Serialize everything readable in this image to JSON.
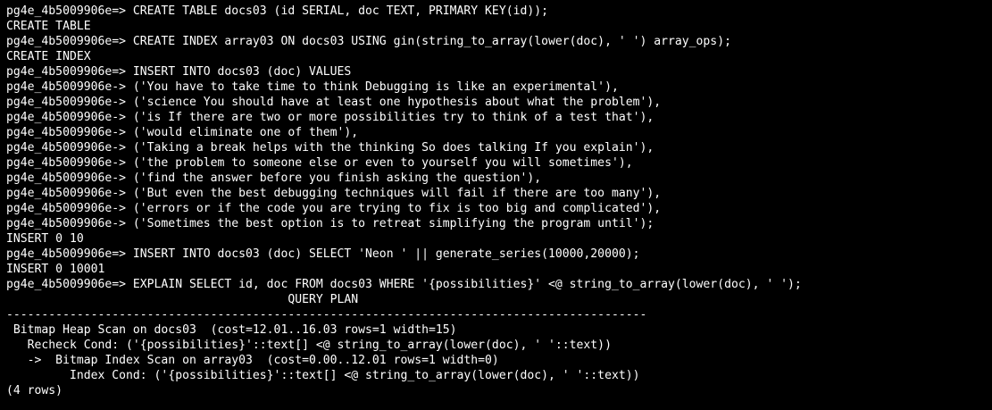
{
  "terminal": {
    "lines": [
      "pg4e_4b5009906e=> CREATE TABLE docs03 (id SERIAL, doc TEXT, PRIMARY KEY(id));",
      "CREATE TABLE",
      "pg4e_4b5009906e=> CREATE INDEX array03 ON docs03 USING gin(string_to_array(lower(doc), ' ') array_ops);",
      "CREATE INDEX",
      "pg4e_4b5009906e=> INSERT INTO docs03 (doc) VALUES",
      "pg4e_4b5009906e-> ('You have to take time to think Debugging is like an experimental'),",
      "pg4e_4b5009906e-> ('science You should have at least one hypothesis about what the problem'),",
      "pg4e_4b5009906e-> ('is If there are two or more possibilities try to think of a test that'),",
      "pg4e_4b5009906e-> ('would eliminate one of them'),",
      "pg4e_4b5009906e-> ('Taking a break helps with the thinking So does talking If you explain'),",
      "pg4e_4b5009906e-> ('the problem to someone else or even to yourself you will sometimes'),",
      "pg4e_4b5009906e-> ('find the answer before you finish asking the question'),",
      "pg4e_4b5009906e-> ('But even the best debugging techniques will fail if there are too many'),",
      "pg4e_4b5009906e-> ('errors or if the code you are trying to fix is too big and complicated'),",
      "pg4e_4b5009906e-> ('Sometimes the best option is to retreat simplifying the program until');",
      "INSERT 0 10",
      "pg4e_4b5009906e=> INSERT INTO docs03 (doc) SELECT 'Neon ' || generate_series(10000,20000);",
      "INSERT 0 10001",
      "pg4e_4b5009906e=> EXPLAIN SELECT id, doc FROM docs03 WHERE '{possibilities}' <@ string_to_array(lower(doc), ' ');",
      "                                        QUERY PLAN",
      "-------------------------------------------------------------------------------------------",
      " Bitmap Heap Scan on docs03  (cost=12.01..16.03 rows=1 width=15)",
      "   Recheck Cond: ('{possibilities}'::text[] <@ string_to_array(lower(doc), ' '::text))",
      "   ->  Bitmap Index Scan on array03  (cost=0.00..12.01 rows=1 width=0)",
      "         Index Cond: ('{possibilities}'::text[] <@ string_to_array(lower(doc), ' '::text))",
      "(4 rows)"
    ]
  }
}
